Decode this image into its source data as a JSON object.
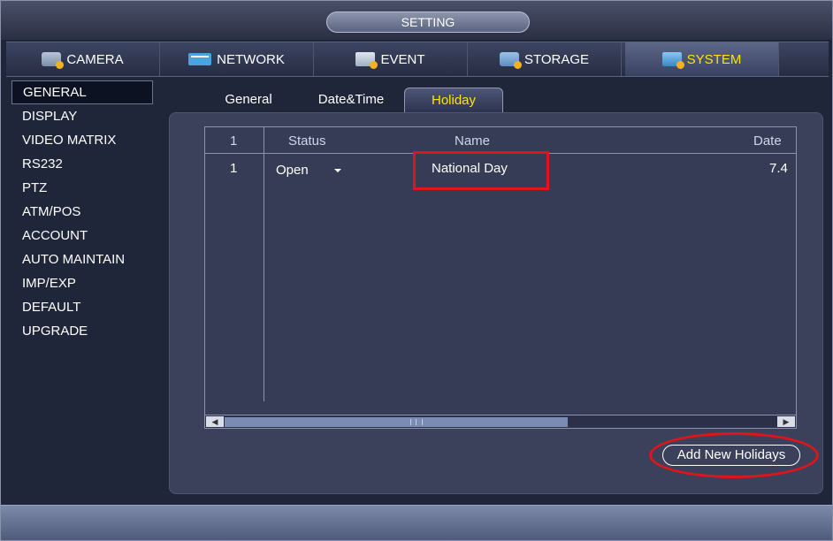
{
  "window": {
    "title": "SETTING"
  },
  "main_tabs": [
    {
      "label": "CAMERA",
      "icon": "camera-icon"
    },
    {
      "label": "NETWORK",
      "icon": "network-icon"
    },
    {
      "label": "EVENT",
      "icon": "event-icon"
    },
    {
      "label": "STORAGE",
      "icon": "storage-icon"
    },
    {
      "label": "SYSTEM",
      "icon": "system-icon",
      "active": true
    }
  ],
  "sidebar": {
    "items": [
      {
        "label": "GENERAL",
        "active": true
      },
      {
        "label": "DISPLAY"
      },
      {
        "label": "VIDEO MATRIX"
      },
      {
        "label": "RS232"
      },
      {
        "label": "PTZ"
      },
      {
        "label": "ATM/POS"
      },
      {
        "label": "ACCOUNT"
      },
      {
        "label": "AUTO MAINTAIN"
      },
      {
        "label": "IMP/EXP"
      },
      {
        "label": "DEFAULT"
      },
      {
        "label": "UPGRADE"
      }
    ]
  },
  "sub_tabs": [
    {
      "label": "General"
    },
    {
      "label": "Date&Time"
    },
    {
      "label": "Holiday",
      "active": true
    }
  ],
  "holiday_table": {
    "headers": {
      "index": "1",
      "status": "Status",
      "name": "Name",
      "date": "Date"
    },
    "rows": [
      {
        "index": "1",
        "status": "Open",
        "name": "National Day",
        "date": "7.4"
      }
    ]
  },
  "actions": {
    "add_label": "Add New Holidays"
  },
  "colors": {
    "active_tab": "#ffe400",
    "highlight": "#e0141a",
    "panel": "#3b415a"
  }
}
